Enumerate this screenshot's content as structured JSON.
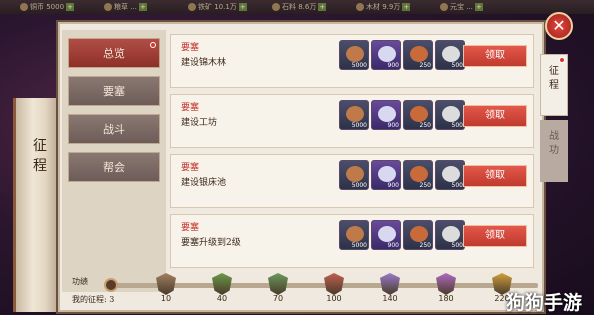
{
  "topbar": {
    "resources": [
      {
        "icon": "copper-coin-icon",
        "text": "铜币 5000"
      },
      {
        "icon": "grain-icon",
        "text": "粮草 ..."
      },
      {
        "icon": "iron-icon",
        "text": "铁矿 10.1万"
      },
      {
        "icon": "stone-icon",
        "text": "石料 8.6万"
      },
      {
        "icon": "wood-icon",
        "text": "木材 9.9万"
      },
      {
        "icon": "gold-icon",
        "text": "元宝 ..."
      }
    ]
  },
  "scroll": {
    "title": "征程"
  },
  "categories": [
    {
      "label": "总览",
      "active": true,
      "dot": true
    },
    {
      "label": "要塞",
      "active": false,
      "dot": false
    },
    {
      "label": "战斗",
      "active": false,
      "dot": false
    },
    {
      "label": "帮会",
      "active": false,
      "dot": false
    }
  ],
  "tasks": [
    {
      "category": "要塞",
      "name": "建设锦木林",
      "claim": "领取",
      "rewards": [
        {
          "icon": "meat-icon",
          "qty": "5000"
        },
        {
          "icon": "crystal-icon",
          "qty": "900"
        },
        {
          "icon": "wood-log-icon",
          "qty": "250"
        },
        {
          "icon": "silver-ingot-icon",
          "qty": "500"
        }
      ]
    },
    {
      "category": "要塞",
      "name": "建设工坊",
      "claim": "领取",
      "rewards": [
        {
          "icon": "meat-icon",
          "qty": "5000"
        },
        {
          "icon": "crystal-icon",
          "qty": "900"
        },
        {
          "icon": "wood-log-icon",
          "qty": "250"
        },
        {
          "icon": "silver-ingot-icon",
          "qty": "500"
        }
      ]
    },
    {
      "category": "要塞",
      "name": "建设银床池",
      "claim": "领取",
      "rewards": [
        {
          "icon": "meat-icon",
          "qty": "5000"
        },
        {
          "icon": "crystal-icon",
          "qty": "900"
        },
        {
          "icon": "wood-log-icon",
          "qty": "250"
        },
        {
          "icon": "silver-ingot-icon",
          "qty": "500"
        }
      ]
    },
    {
      "category": "要塞",
      "name": "要塞升级到2级",
      "claim": "领取",
      "rewards": [
        {
          "icon": "meat-icon",
          "qty": "5000"
        },
        {
          "icon": "crystal-icon",
          "qty": "900"
        },
        {
          "icon": "wood-log-icon",
          "qty": "250"
        },
        {
          "icon": "silver-ingot-icon",
          "qty": "500"
        }
      ]
    }
  ],
  "right_tabs": [
    {
      "label": "征程",
      "active": true
    },
    {
      "label": "战功",
      "active": false
    }
  ],
  "progress": {
    "label_merit": "功绩",
    "label_mine": "我的征程: 3",
    "current": 3,
    "milestones": [
      {
        "value": "10",
        "color": "#a08060"
      },
      {
        "value": "40",
        "color": "#6a9a4a"
      },
      {
        "value": "70",
        "color": "#6a9a5a"
      },
      {
        "value": "100",
        "color": "#c06050"
      },
      {
        "value": "140",
        "color": "#9a7aca"
      },
      {
        "value": "180",
        "color": "#b06ac0"
      },
      {
        "value": "220",
        "color": "#d0a040"
      }
    ]
  },
  "close": {
    "glyph": "✕"
  },
  "watermark": "狗狗手游"
}
